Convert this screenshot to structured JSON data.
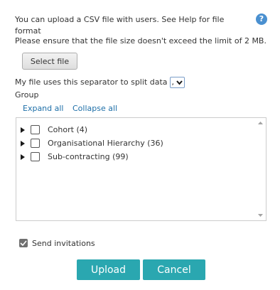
{
  "dialog": {
    "intro_text": "You can upload a CSV file with users. See Help for file format",
    "help_icon": "help-icon",
    "limit_text": "Please ensure that the file size doesn't exceed the limit of 2 MB.",
    "select_file_label": "Select file",
    "separator_label": "My file uses this separator to split data",
    "separator_value": ",",
    "group_label": "Group",
    "expand_all_label": "Expand all",
    "collapse_all_label": "Collapse all",
    "tree_items": [
      {
        "label": "Cohort (4)",
        "checked": false
      },
      {
        "label": "Organisational Hierarchy (36)",
        "checked": false
      },
      {
        "label": "Sub-contracting (99)",
        "checked": false
      }
    ],
    "send_invitations_label": "Send invitations",
    "send_invitations_checked": true,
    "upload_label": "Upload",
    "cancel_label": "Cancel"
  },
  "colors": {
    "accent": "#2aa7b0",
    "link": "#1e6fa8",
    "help": "#4a90d0"
  }
}
